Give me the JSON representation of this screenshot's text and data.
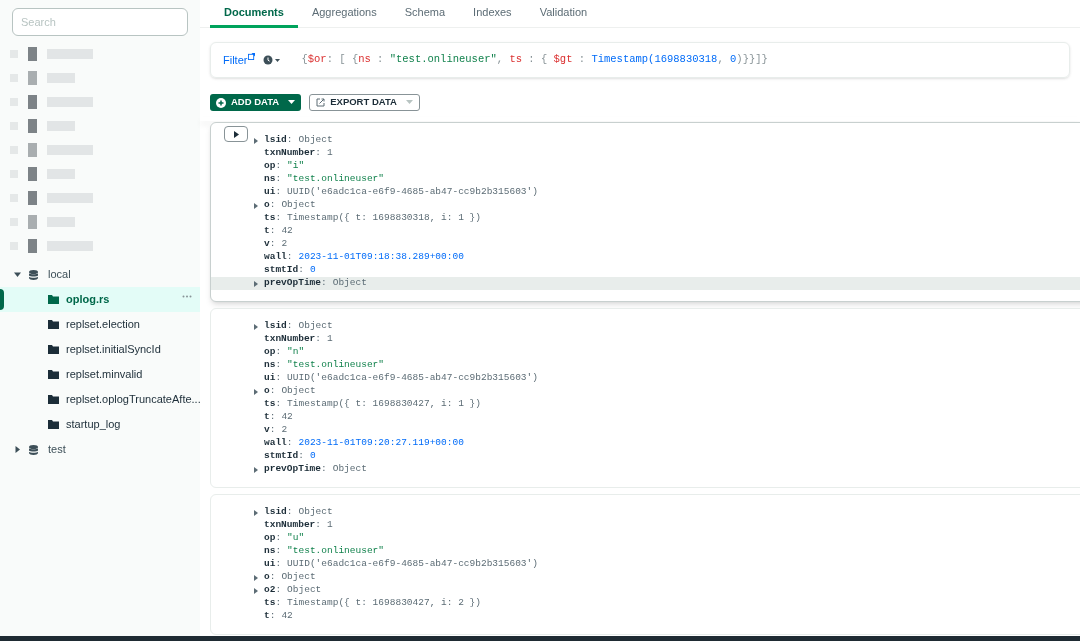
{
  "sidebar": {
    "search": {
      "placeholder": "Search"
    },
    "tree": [
      {
        "label": "local",
        "expanded": true,
        "children": [
          {
            "label": "oplog.rs",
            "selected": true
          },
          {
            "label": "replset.election",
            "selected": false
          },
          {
            "label": "replset.initialSyncId",
            "selected": false
          },
          {
            "label": "replset.minvalid",
            "selected": false
          },
          {
            "label": "replset.oplogTruncateAfte...",
            "selected": false
          },
          {
            "label": "startup_log",
            "selected": false
          }
        ]
      },
      {
        "label": "test",
        "expanded": false
      }
    ]
  },
  "tabs": [
    {
      "label": "Documents",
      "selected": true
    },
    {
      "label": "Aggregations",
      "selected": false
    },
    {
      "label": "Schema",
      "selected": false
    },
    {
      "label": "Indexes",
      "selected": false
    },
    {
      "label": "Validation",
      "selected": false
    }
  ],
  "filter": {
    "label": "Filter",
    "query": [
      {
        "text": "{",
        "kind": "punct"
      },
      {
        "text": "$or",
        "kind": "key"
      },
      {
        "text": ": [ {",
        "kind": "punct"
      },
      {
        "text": "ns",
        "kind": "key"
      },
      {
        "text": " : ",
        "kind": "punct"
      },
      {
        "text": "\"test.onlineuser\"",
        "kind": "string"
      },
      {
        "text": ", ",
        "kind": "punct"
      },
      {
        "text": "ts",
        "kind": "key"
      },
      {
        "text": " : { ",
        "kind": "punct"
      },
      {
        "text": "$gt",
        "kind": "key"
      },
      {
        "text": " : ",
        "kind": "punct"
      },
      {
        "text": "Timestamp(",
        "kind": "number"
      },
      {
        "text": "1698830318",
        "kind": "number"
      },
      {
        "text": ", ",
        "kind": "punct"
      },
      {
        "text": "0",
        "kind": "number"
      },
      {
        "text": ")}}]}",
        "kind": "punct"
      }
    ]
  },
  "actions": [
    {
      "label": "ADD DATA",
      "kind": "primary"
    },
    {
      "label": "EXPORT DATA",
      "kind": "secondary"
    }
  ],
  "documents": [
    {
      "hovered": true,
      "fields": [
        {
          "key": "**lsid**:",
          "value": "Object",
          "kind": "object",
          "expandable": true,
          "highlighted": false
        },
        {
          "key": "**txnNumber**:",
          "value": "1",
          "kind": "plain",
          "expandable": false,
          "highlighted": false
        },
        {
          "key": "**op**:",
          "value": "\"i\"",
          "kind": "string",
          "expandable": false,
          "highlighted": false
        },
        {
          "key": "**ns**:",
          "value": "\"test.onlineuser\"",
          "kind": "string",
          "expandable": false,
          "highlighted": false
        },
        {
          "key": "**ui**:",
          "value": "UUID('e6adc1ca-e6f9-4685-ab47-cc9b2b315603')",
          "kind": "plain",
          "expandable": false,
          "highlighted": false
        },
        {
          "key": "**o**:",
          "value": "Object",
          "kind": "object",
          "expandable": true,
          "highlighted": false
        },
        {
          "key": "**ts**:",
          "value": "Timestamp({ t: 1698830318, i: 1 })",
          "kind": "plain",
          "expandable": false,
          "highlighted": false
        },
        {
          "key": "**t**:",
          "value": "42",
          "kind": "plain",
          "expandable": false,
          "highlighted": false
        },
        {
          "key": "**v**:",
          "value": "2",
          "kind": "plain",
          "expandable": false,
          "highlighted": false
        },
        {
          "key": "**wall**:",
          "value": "2023-11-01T09:18:38.289+00:00",
          "kind": "date",
          "expandable": false,
          "highlighted": false
        },
        {
          "key": "**stmtId**:",
          "value": "0",
          "kind": "int",
          "expandable": false,
          "highlighted": false
        },
        {
          "key": "**prevOpTime**:",
          "value": "Object",
          "kind": "object",
          "expandable": true,
          "highlighted": true
        }
      ]
    },
    {
      "hovered": false,
      "fields": [
        {
          "key": "**lsid**:",
          "value": "Object",
          "kind": "object",
          "expandable": true,
          "highlighted": false
        },
        {
          "key": "**txnNumber**:",
          "value": "1",
          "kind": "plain",
          "expandable": false,
          "highlighted": false
        },
        {
          "key": "**op**:",
          "value": "\"n\"",
          "kind": "string",
          "expandable": false,
          "highlighted": false
        },
        {
          "key": "**ns**:",
          "value": "\"test.onlineuser\"",
          "kind": "string",
          "expandable": false,
          "highlighted": false
        },
        {
          "key": "**ui**:",
          "value": "UUID('e6adc1ca-e6f9-4685-ab47-cc9b2b315603')",
          "kind": "plain",
          "expandable": false,
          "highlighted": false
        },
        {
          "key": "**o**:",
          "value": "Object",
          "kind": "object",
          "expandable": true,
          "highlighted": false
        },
        {
          "key": "**ts**:",
          "value": "Timestamp({ t: 1698830427, i: 1 })",
          "kind": "plain",
          "expandable": false,
          "highlighted": false
        },
        {
          "key": "**t**:",
          "value": "42",
          "kind": "plain",
          "expandable": false,
          "highlighted": false
        },
        {
          "key": "**v**:",
          "value": "2",
          "kind": "plain",
          "expandable": false,
          "highlighted": false
        },
        {
          "key": "**wall**:",
          "value": "2023-11-01T09:20:27.119+00:00",
          "kind": "date",
          "expandable": false,
          "highlighted": false
        },
        {
          "key": "**stmtId**:",
          "value": "0",
          "kind": "int",
          "expandable": false,
          "highlighted": false
        },
        {
          "key": "**prevOpTime**:",
          "value": "Object",
          "kind": "object",
          "expandable": true,
          "highlighted": false
        }
      ]
    },
    {
      "hovered": false,
      "fields": [
        {
          "key": "**lsid**:",
          "value": "Object",
          "kind": "object",
          "expandable": true,
          "highlighted": false
        },
        {
          "key": "**txnNumber**:",
          "value": "1",
          "kind": "plain",
          "expandable": false,
          "highlighted": false
        },
        {
          "key": "**op**:",
          "value": "\"u\"",
          "kind": "string",
          "expandable": false,
          "highlighted": false
        },
        {
          "key": "**ns**:",
          "value": "\"test.onlineuser\"",
          "kind": "string",
          "expandable": false,
          "highlighted": false
        },
        {
          "key": "**ui**:",
          "value": "UUID('e6adc1ca-e6f9-4685-ab47-cc9b2b315603')",
          "kind": "plain",
          "expandable": false,
          "highlighted": false
        },
        {
          "key": "**o**:",
          "value": "Object",
          "kind": "object",
          "expandable": true,
          "highlighted": false
        },
        {
          "key": "**o2**:",
          "value": "Object",
          "kind": "object",
          "expandable": true,
          "highlighted": false
        },
        {
          "key": "**ts**:",
          "value": "Timestamp({ t: 1698830427, i: 2 })",
          "kind": "plain",
          "expandable": false,
          "highlighted": false
        },
        {
          "key": "**t**:",
          "value": "42",
          "kind": "plain",
          "expandable": false,
          "highlighted": false
        }
      ]
    }
  ]
}
